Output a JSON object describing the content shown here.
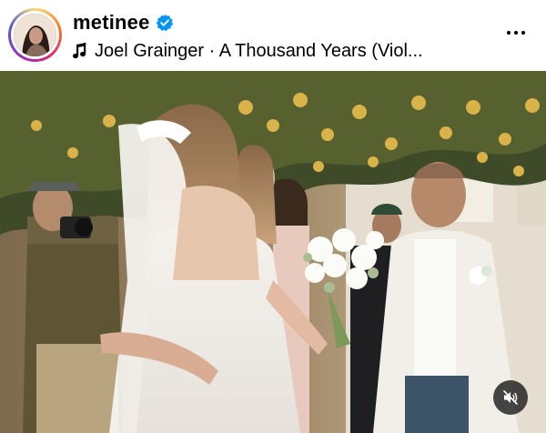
{
  "post": {
    "username": "metinee",
    "verified": true,
    "audio": "Joel Grainger · A Thousand Years (Viol...",
    "more_icon": "more-horizontal-icon",
    "media": {
      "description_icon": "wedding-photo",
      "mute_icon": "speaker-muted-icon"
    }
  },
  "colors": {
    "verified_blue": "#0095f6",
    "text": "#000000",
    "mute_button_bg": "#262626"
  }
}
